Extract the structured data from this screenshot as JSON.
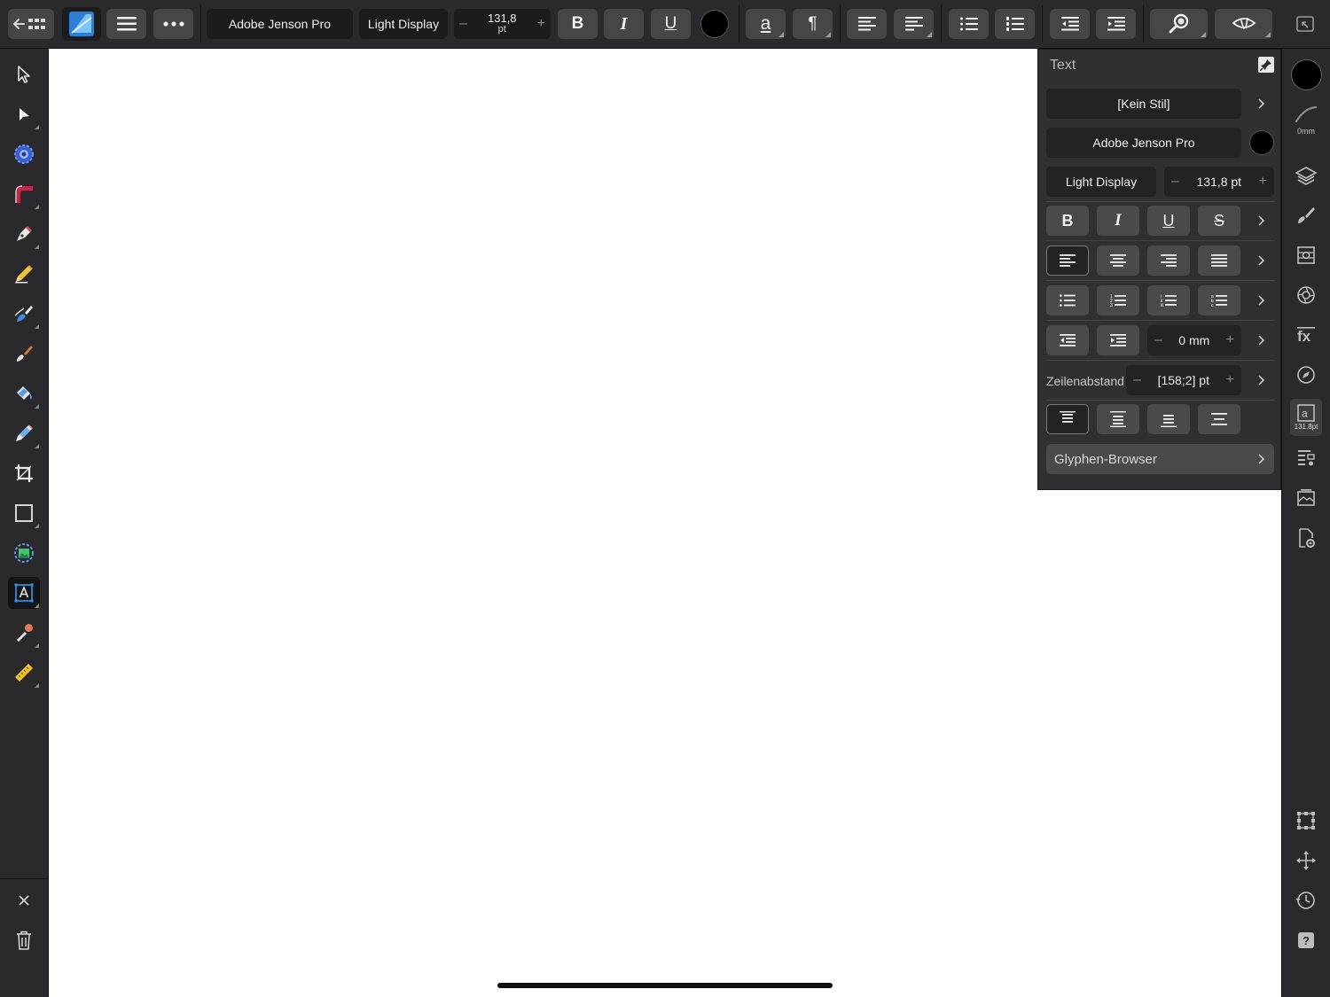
{
  "toolbar": {
    "font_family": "Adobe Jenson Pro",
    "font_style": "Light Display",
    "font_size_value": "131,8",
    "font_size_unit": "pt",
    "minus": "–",
    "plus": "+",
    "bold_label": "B",
    "italic_label": "I",
    "underline_label": "U",
    "text_color": "#000000",
    "char_label": "a",
    "para_label": "¶"
  },
  "panel": {
    "title": "Text",
    "style": "[Kein Stil]",
    "font_family": "Adobe Jenson Pro",
    "font_color": "#000000",
    "font_style": "Light Display",
    "font_size": "131,8 pt",
    "bold": "B",
    "italic": "I",
    "underline": "U",
    "strike": "S",
    "indent_value": "0 mm",
    "leading_label": "Zeilenabstand",
    "leading_value": "[158;2] pt",
    "glyph_browser": "Glyphen-Browser",
    "minus": "–",
    "plus": "+"
  },
  "studio": {
    "stroke_color": "#000000",
    "stroke_width": "0mm",
    "text_size_badge": "131.8pt"
  },
  "colors": {
    "accent": "#2d9cf0",
    "canvas": "#ffffff",
    "chrome": "#2a2a2c"
  }
}
